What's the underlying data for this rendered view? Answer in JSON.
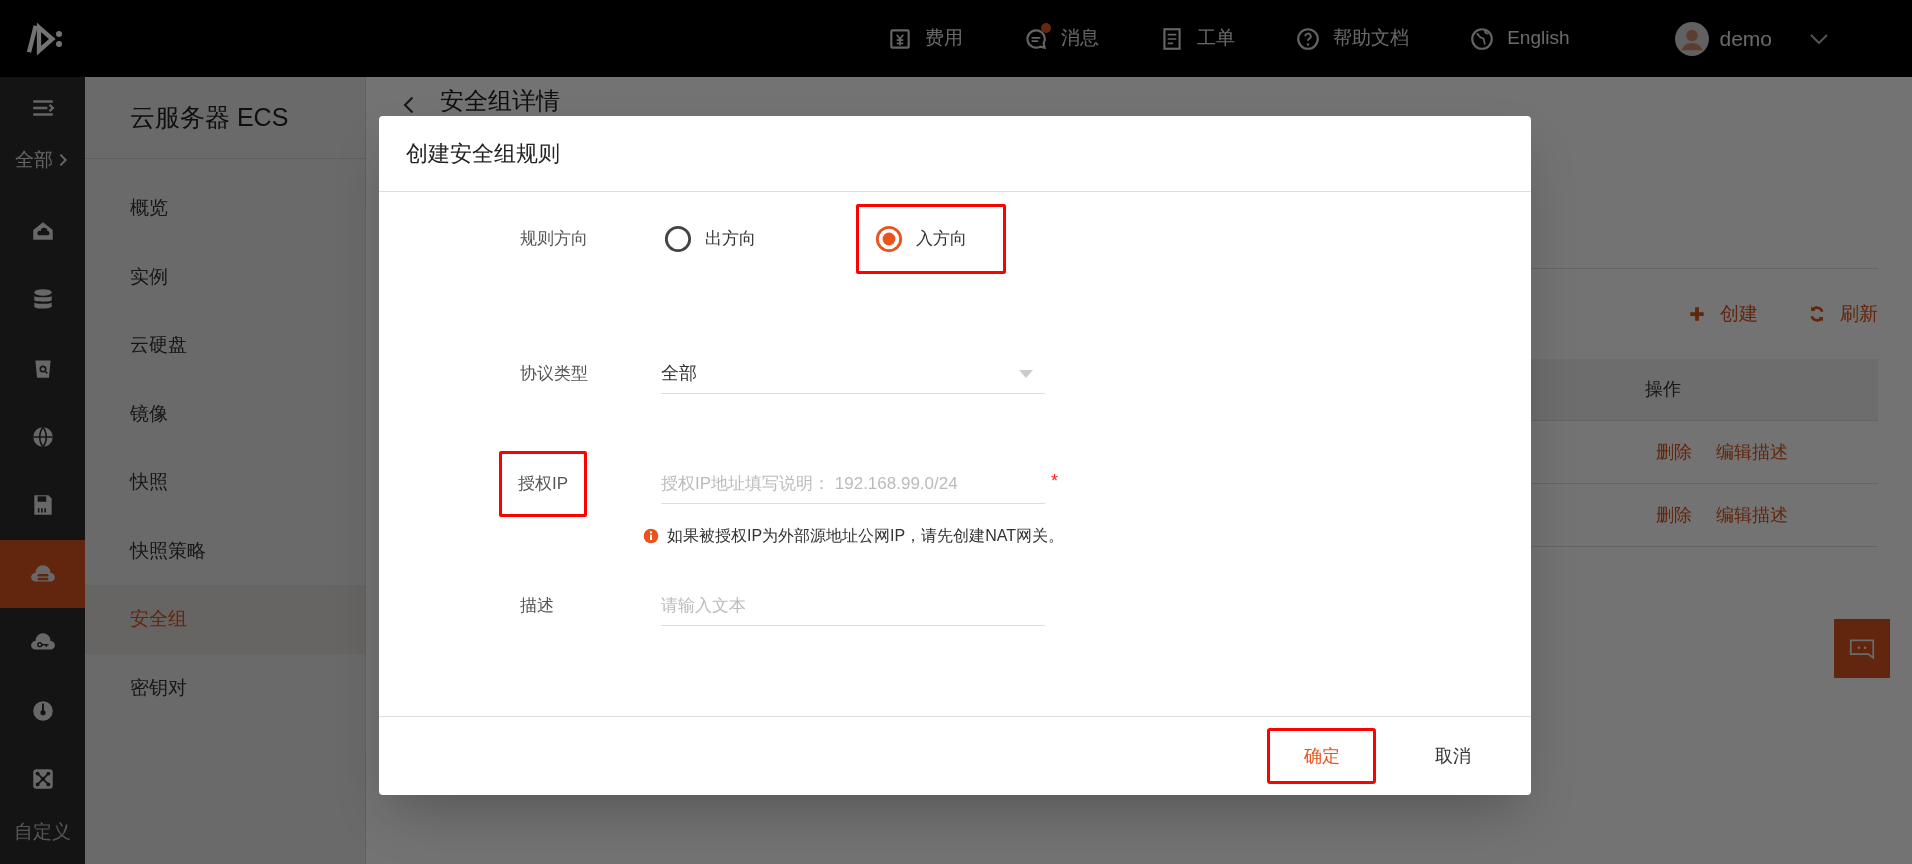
{
  "top_bar": {
    "nav": [
      {
        "label": "费用",
        "badge": false
      },
      {
        "label": "消息",
        "badge": true
      },
      {
        "label": "工单",
        "badge": false
      },
      {
        "label": "帮助文档",
        "badge": false
      },
      {
        "label": "English",
        "badge": false
      }
    ],
    "user": "demo"
  },
  "rail": {
    "all_label": "全部",
    "items": [
      {
        "selected": false
      },
      {
        "selected": false
      },
      {
        "selected": false
      },
      {
        "selected": false
      },
      {
        "selected": false
      },
      {
        "selected": true
      },
      {
        "selected": false
      },
      {
        "selected": false
      },
      {
        "selected": false
      }
    ],
    "custom_label": "自定义"
  },
  "sidebar": {
    "title": "云服务器 ECS",
    "items": [
      {
        "label": "概览",
        "selected": false
      },
      {
        "label": "实例",
        "selected": false
      },
      {
        "label": "云硬盘",
        "selected": false
      },
      {
        "label": "镜像",
        "selected": false
      },
      {
        "label": "快照",
        "selected": false
      },
      {
        "label": "快照策略",
        "selected": false
      },
      {
        "label": "安全组",
        "selected": true
      },
      {
        "label": "密钥对",
        "selected": false
      }
    ]
  },
  "page": {
    "title": "安全组详情",
    "actions": [
      "创建",
      "刷新"
    ],
    "table": {
      "columns": [
        "操作"
      ],
      "rows": [
        {
          "actions": [
            "删除",
            "编辑描述"
          ]
        },
        {
          "actions": [
            "删除",
            "编辑描述"
          ]
        }
      ]
    }
  },
  "dialog": {
    "title": "创建安全组规则",
    "fields": [
      {
        "kind": "radio",
        "label": "规则方向",
        "highlighted": false,
        "options": [
          {
            "label": "出方向",
            "selected": false,
            "highlighted": false
          },
          {
            "label": "入方向",
            "selected": true,
            "highlighted": true
          }
        ]
      },
      {
        "kind": "select",
        "label": "协议类型",
        "highlighted": false,
        "value": "全部"
      },
      {
        "kind": "input",
        "label": "授权IP",
        "highlighted": true,
        "placeholder": "授权IP地址填写说明： 192.168.99.0/24",
        "required_mark": "*",
        "hint": "如果被授权IP为外部源地址公网IP，请先创建NAT网关。"
      },
      {
        "kind": "input",
        "label": "描述",
        "highlighted": false,
        "placeholder": "请输入文本"
      }
    ],
    "buttons": [
      {
        "label": "确定",
        "primary": true,
        "highlighted": true
      },
      {
        "label": "取消",
        "primary": false,
        "highlighted": false
      }
    ]
  }
}
